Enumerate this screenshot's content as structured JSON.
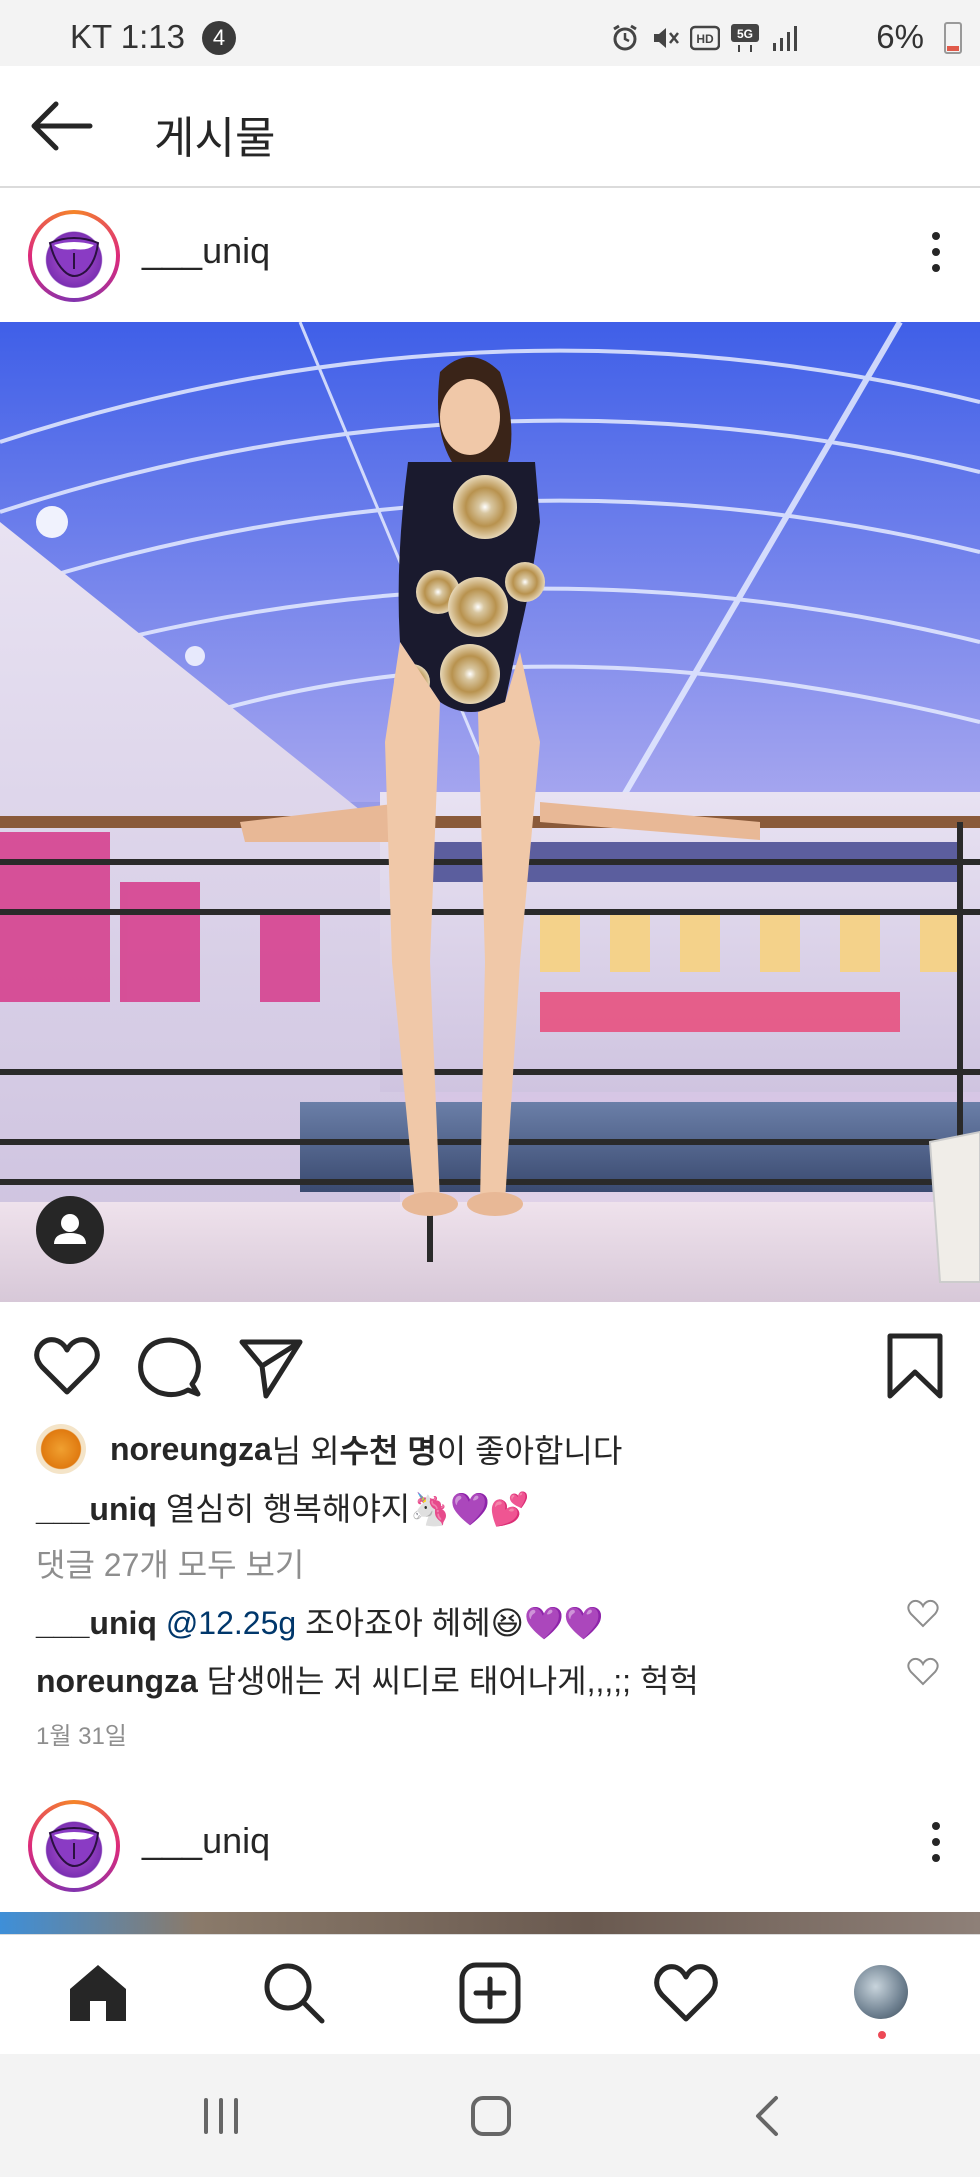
{
  "status_bar": {
    "carrier_time": "KT 1:13",
    "notification_count": "4",
    "battery": "6%",
    "icons": [
      "alarm-icon",
      "mute-icon",
      "hd-icon",
      "5g-icon",
      "signal-icon"
    ]
  },
  "header": {
    "title": "게시물",
    "back_icon": "arrow-left-icon"
  },
  "post": {
    "username": "___uniq",
    "likes": {
      "user": "noreungza",
      "text_1": "님 외 ",
      "count_text": "수천 명",
      "text_2": "이 좋아합니다"
    },
    "caption": {
      "user": "___uniq",
      "text": " 열심히 행복해야지",
      "emojis": "🦄💜💕"
    },
    "view_comments": "댓글 27개 모두 보기",
    "comments": [
      {
        "user": "___uniq",
        "mention": " @12.25g",
        "text": " 조아죠아 헤헤",
        "emojis": "😆💜💜"
      },
      {
        "user": "noreungza",
        "text": " 담생애는 저 씨디로 태어나게,,,;; 헉헉"
      }
    ],
    "date": "1월 31일"
  },
  "next_post": {
    "username": "___uniq"
  },
  "bottom_nav": {
    "items": [
      "home-icon",
      "search-icon",
      "add-post-icon",
      "activity-heart-icon",
      "profile-avatar"
    ]
  },
  "system_nav": {
    "items": [
      "recent-apps-icon",
      "home-button-icon",
      "back-icon"
    ]
  },
  "colors": {
    "text": "#262626",
    "muted": "#8e8e8e",
    "mention": "#00376b",
    "notification_dot": "#ed4956"
  }
}
